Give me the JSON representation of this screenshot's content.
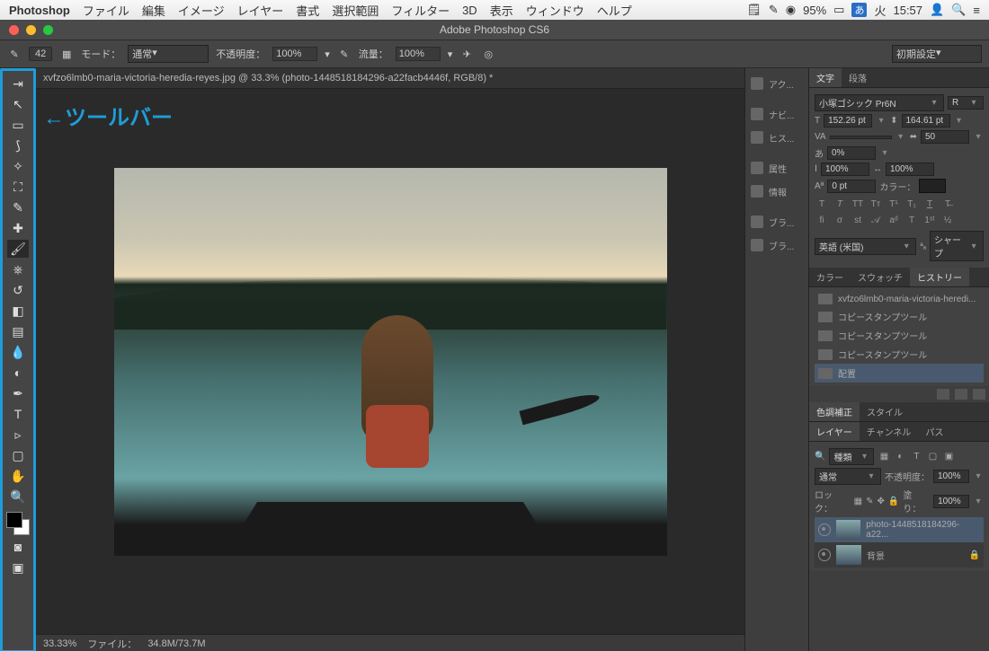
{
  "menubar": {
    "app": "Photoshop",
    "items": [
      "ファイル",
      "編集",
      "イメージ",
      "レイヤー",
      "書式",
      "選択範囲",
      "フィルター",
      "3D",
      "表示",
      "ウィンドウ",
      "ヘルプ"
    ],
    "status": {
      "battery": "95%",
      "ime": "あ",
      "day": "火",
      "time": "15:57"
    }
  },
  "window": {
    "title": "Adobe Photoshop CS6"
  },
  "options": {
    "brush_size": "42",
    "mode_label": "モード：",
    "mode_value": "通常",
    "opacity_label": "不透明度：",
    "opacity_value": "100%",
    "flow_label": "流量：",
    "flow_value": "100%",
    "preset_label": "初期設定"
  },
  "annotation": "←ツールバー",
  "document": {
    "tab": "xvfzo6lmb0-maria-victoria-heredia-reyes.jpg @ 33.3% (photo-1448518184296-a22facb4446f, RGB/8) *",
    "zoom": "33.33%",
    "filesize_label": "ファイル：",
    "filesize": "34.8M/73.7M"
  },
  "panelstrip": {
    "items": [
      "アク...",
      "ナビ...",
      "ヒス...",
      "属性",
      "情報",
      "ブラ...",
      "ブラ..."
    ]
  },
  "char_panel": {
    "tabs": [
      "文字",
      "段落"
    ],
    "font": "小塚ゴシック Pr6N",
    "style": "R",
    "size": "152.26 pt",
    "leading": "164.61 pt",
    "tracking": "50",
    "kerning": "0%",
    "hscale": "100%",
    "vscale": "100%",
    "baseline": "0 pt",
    "color_label": "カラー：",
    "lang": "英語 (米国)",
    "aa": "シャープ"
  },
  "swatch_panel": {
    "tabs": [
      "カラー",
      "スウォッチ",
      "ヒストリー"
    ]
  },
  "history": {
    "doc": "xvfzo6lmb0-maria-victoria-heredi...",
    "items": [
      "コピースタンプツール",
      "コピースタンプツール",
      "コピースタンプツール",
      "配置"
    ]
  },
  "adjust_panel": {
    "tabs": [
      "色調補正",
      "スタイル"
    ]
  },
  "layers_panel": {
    "tabs": [
      "レイヤー",
      "チャンネル",
      "パス"
    ],
    "kind_label": "種類",
    "blend": "通常",
    "opacity_label": "不透明度：",
    "opacity": "100%",
    "lock_label": "ロック：",
    "fill_label": "塗り：",
    "fill": "100%",
    "layers": [
      {
        "name": "photo-1448518184296-a22...",
        "selected": true
      },
      {
        "name": "背景",
        "selected": false
      }
    ]
  }
}
